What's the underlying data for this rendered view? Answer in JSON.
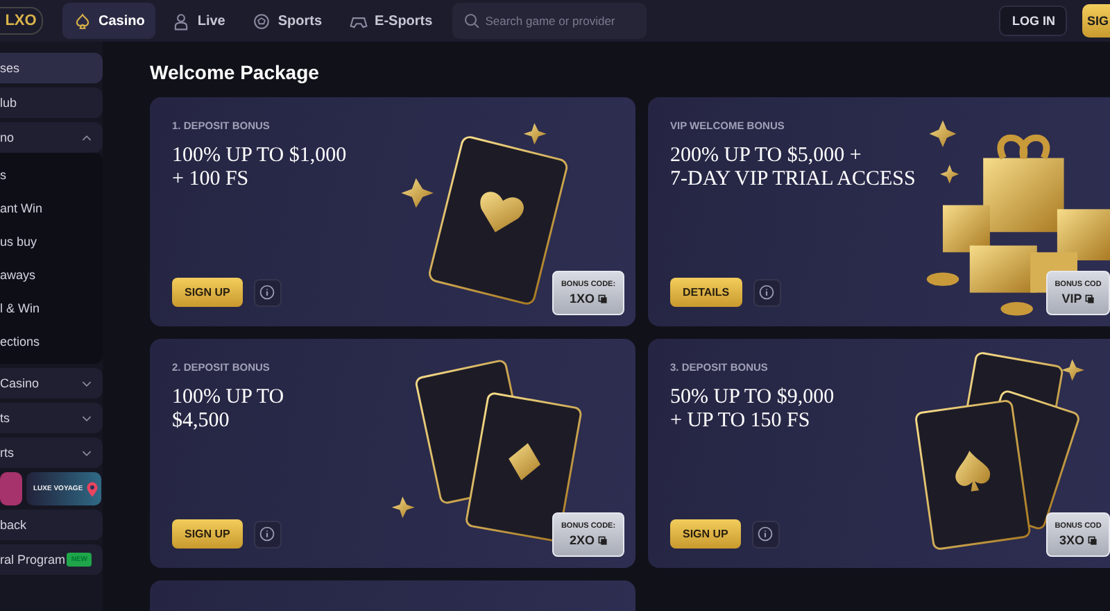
{
  "header": {
    "logo": "LXO",
    "nav": [
      {
        "label": "Casino",
        "kind": "spade",
        "selected": true
      },
      {
        "label": "Live",
        "kind": "dealer",
        "selected": false
      },
      {
        "label": "Sports",
        "kind": "ball",
        "selected": false
      },
      {
        "label": "E-Sports",
        "kind": "gamepad",
        "selected": false
      }
    ],
    "search": {
      "placeholder": "Search game or provider"
    },
    "login": "LOG IN",
    "signup": "SIG"
  },
  "sidebar": {
    "items": [
      {
        "label": "ses",
        "selected": true
      },
      {
        "label": "lub",
        "selected": false
      },
      {
        "label": "no",
        "selected": false,
        "expanded": true,
        "children": [
          {
            "label": "s"
          },
          {
            "label": "ant Win"
          },
          {
            "label": "us buy"
          },
          {
            "label": "aways"
          },
          {
            "label": "l & Win"
          },
          {
            "label": "ections"
          }
        ]
      },
      {
        "label": "Casino",
        "selected": false,
        "expanded": false
      },
      {
        "label": "ts",
        "selected": false,
        "expanded": false
      },
      {
        "label": "rts",
        "selected": false,
        "expanded": false
      }
    ],
    "promos": [
      {
        "kind": "photo"
      },
      {
        "kind": "voyage",
        "label": "LUXE VOYAGE"
      }
    ],
    "bottom": [
      {
        "label": "back",
        "selected": false
      },
      {
        "label": "ral Program",
        "selected": false,
        "badge": "NEW"
      }
    ]
  },
  "page_title": "Welcome Package",
  "cards": [
    {
      "eyebrow": "1. DEPOSIT BONUS",
      "title": "100% UP TO $1,000\n+ 100 FS",
      "button": "SIGN UP",
      "kind": "ace-heart",
      "code_label": "BONUS CODE:",
      "code": "1XO"
    },
    {
      "eyebrow": "VIP WELCOME BONUS",
      "title": "200% UP TO $5,000 +\n7-DAY VIP TRIAL ACCESS",
      "button": "DETAILS",
      "kind": "gifts",
      "code_label": "BONUS COD",
      "code": "VIP"
    },
    {
      "eyebrow": "2. DEPOSIT BONUS",
      "title": "100% UP TO\n$4,500",
      "button": "SIGN UP",
      "kind": "two-aces",
      "code_label": "BONUS CODE:",
      "code": "2XO"
    },
    {
      "eyebrow": "3. DEPOSIT BONUS",
      "title": "50% UP TO $9,000\n+ UP TO 150 FS",
      "button": "SIGN UP",
      "kind": "three-aces",
      "code_label": "BONUS COD",
      "code": "3XO"
    }
  ]
}
